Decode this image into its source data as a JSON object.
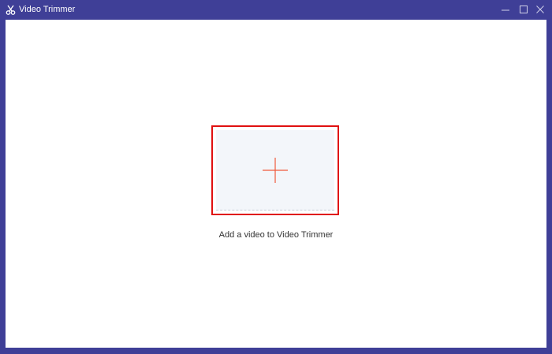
{
  "window": {
    "title": "Video Trimmer",
    "icons": {
      "app": "scissors-icon",
      "minimize": "minimize-icon",
      "maximize": "maximize-icon",
      "close": "close-icon"
    }
  },
  "main": {
    "add_icon": "plus-icon",
    "caption": "Add a video to Video Trimmer"
  },
  "colors": {
    "titlebar": "#3f3f97",
    "highlight_border": "#e01010",
    "plus_color": "#f05a3c",
    "drop_background": "#f3f6fa"
  }
}
